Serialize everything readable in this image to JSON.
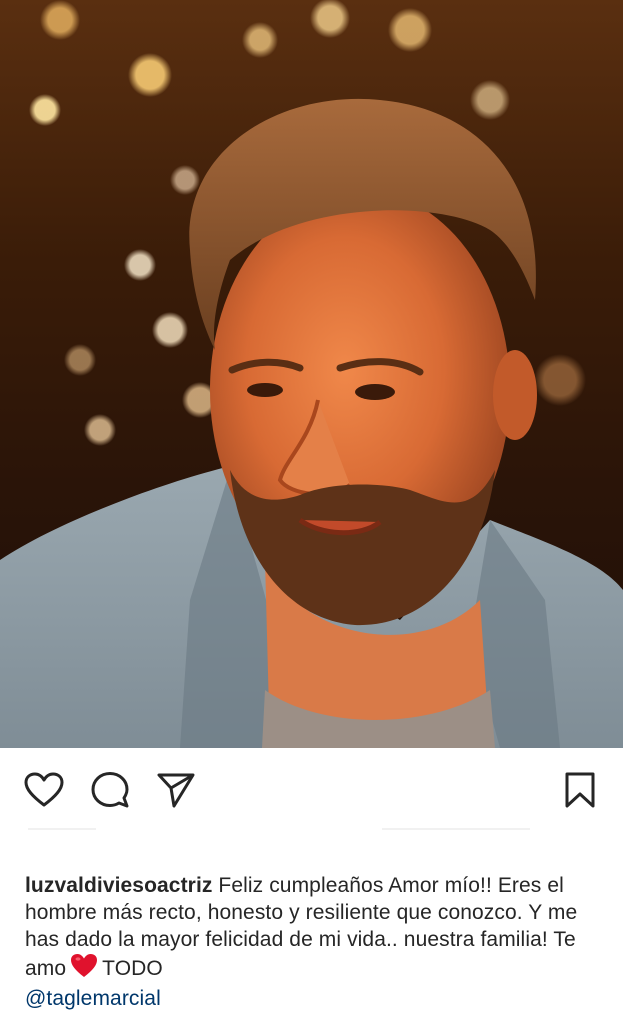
{
  "post": {
    "username": "luzvaldiviesoactriz",
    "caption_line1": "Feliz cumpleaños Amor mío!!",
    "caption_line2": "Eres el hombre más recto, honesto y resiliente que conozco. Y me has dado la mayor felicidad de mi vida.. nuestra familia! Te amo",
    "caption_after_emoji": "TODO",
    "mention": "@taglemarcial"
  },
  "actions": {
    "like_icon": "heart-outline-icon",
    "comment_icon": "comment-bubble-icon",
    "share_icon": "paper-plane-icon",
    "save_icon": "bookmark-icon"
  },
  "colors": {
    "text": "#262626",
    "mention": "#00376b",
    "emoji_heart": "#e0122d"
  }
}
